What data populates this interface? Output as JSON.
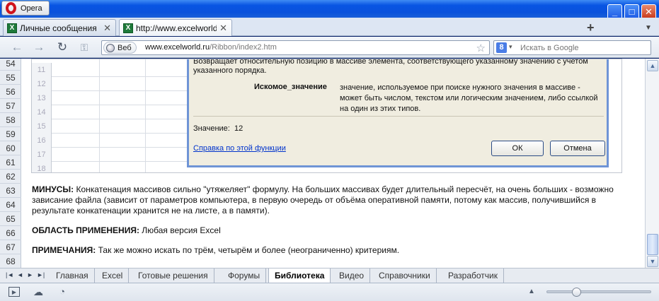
{
  "window": {
    "app_button": "Opera",
    "minimize": "_",
    "maximize": "□",
    "close": "✕"
  },
  "tabs": [
    {
      "label": "Личные сообщения",
      "icon": "X",
      "close": "✕"
    },
    {
      "label": "http://www.excelworld...",
      "icon": "X",
      "close": "✕"
    }
  ],
  "tabbar": {
    "new_tab": "+",
    "menu": "▼"
  },
  "address": {
    "web_badge": "Веб",
    "url_host": "www.excelworld.ru",
    "url_path": "/Ribbon/index2.htm",
    "star": "☆"
  },
  "search": {
    "engine": "8",
    "dropdown": "▾",
    "placeholder": "Искать в Google"
  },
  "row_numbers": [
    "54",
    "55",
    "56",
    "57",
    "58",
    "59",
    "60",
    "61",
    "62",
    "63",
    "64",
    "65",
    "66",
    "67",
    "68"
  ],
  "excel_rows": [
    "11",
    "12",
    "13",
    "14",
    "15",
    "16",
    "17",
    "18"
  ],
  "dialog": {
    "top_text": "Возвращает относительную позицию в массиве элемента, соответствующего указанному значению с учетом указанного порядка.",
    "arg_name": "Искомое_значение",
    "arg_desc": "значение, используемое при поиске нужного значения в массиве - может быть числом, текстом или логическим значением, либо ссылкой на один из этих типов.",
    "value_label": "Значение:",
    "value": "12",
    "help_link": "Справка по этой функции",
    "ok": "ОК",
    "cancel": "Отмена"
  },
  "article": {
    "minus_label": "МИНУСЫ:",
    "minus_text": " Конкатенация массивов сильно \"утяжеляет\" формулу. На больших массивах будет длительный пересчёт, на очень больших - возможно зависание файла (зависит от параметров компьютера, в первую очередь от объёма оперативной памяти, потому как массив, получившийся в результате конкатенации хранится не на листе, а в памяти).",
    "scope_label": "ОБЛАСТЬ ПРИМЕНЕНИЯ:",
    "scope_text": " Любая версия Excel",
    "notes_label": "ПРИМЕЧАНИЯ:",
    "notes_text": " Так же можно искать по трём, четырём и более (неограниченно) критериям."
  },
  "sheet_tabs": [
    "Главная",
    "Excel",
    "Готовые решения",
    "Форумы",
    "Библиотека",
    "Видео",
    "Справочники",
    "Разработчик"
  ],
  "active_sheet_tab": "Библиотека",
  "sheet_nav": [
    "|◄",
    "◄",
    "►",
    "►|"
  ],
  "status_icons": [
    "panel-icon",
    "cloud-icon",
    "speedometer-icon"
  ],
  "zoom": {
    "fraction": 0.28,
    "label_icon": "▲"
  }
}
